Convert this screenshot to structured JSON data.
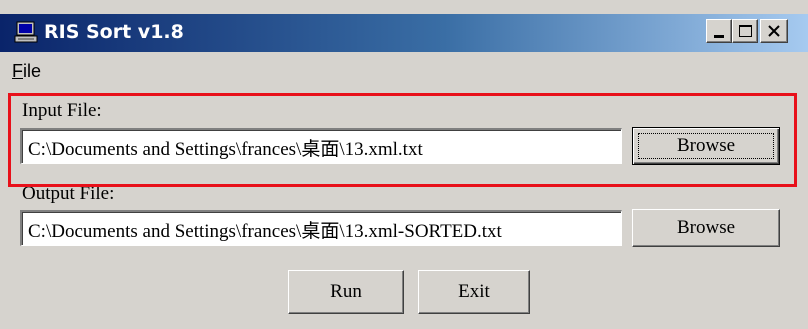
{
  "window": {
    "title": "RIS Sort v1.8",
    "icon": "computer-icon",
    "controls": [
      "minimize-icon",
      "maximize-icon",
      "close-icon"
    ]
  },
  "menu": {
    "file_label_first": "F",
    "file_label_rest": "ile"
  },
  "input": {
    "label": "Input File:",
    "value": "C:\\Documents and Settings\\frances\\桌面\\13.xml.txt",
    "browse_label": "Browse"
  },
  "output": {
    "label": "Output File:",
    "value": "C:\\Documents and Settings\\frances\\桌面\\13.xml-SORTED.txt",
    "browse_label": "Browse"
  },
  "actions": {
    "run_label": "Run",
    "exit_label": "Exit"
  },
  "colors": {
    "highlight": "#e8101a",
    "title_bar_start": "#0a246a",
    "title_bar_end": "#a6caf0",
    "face": "#d6d3ce"
  }
}
